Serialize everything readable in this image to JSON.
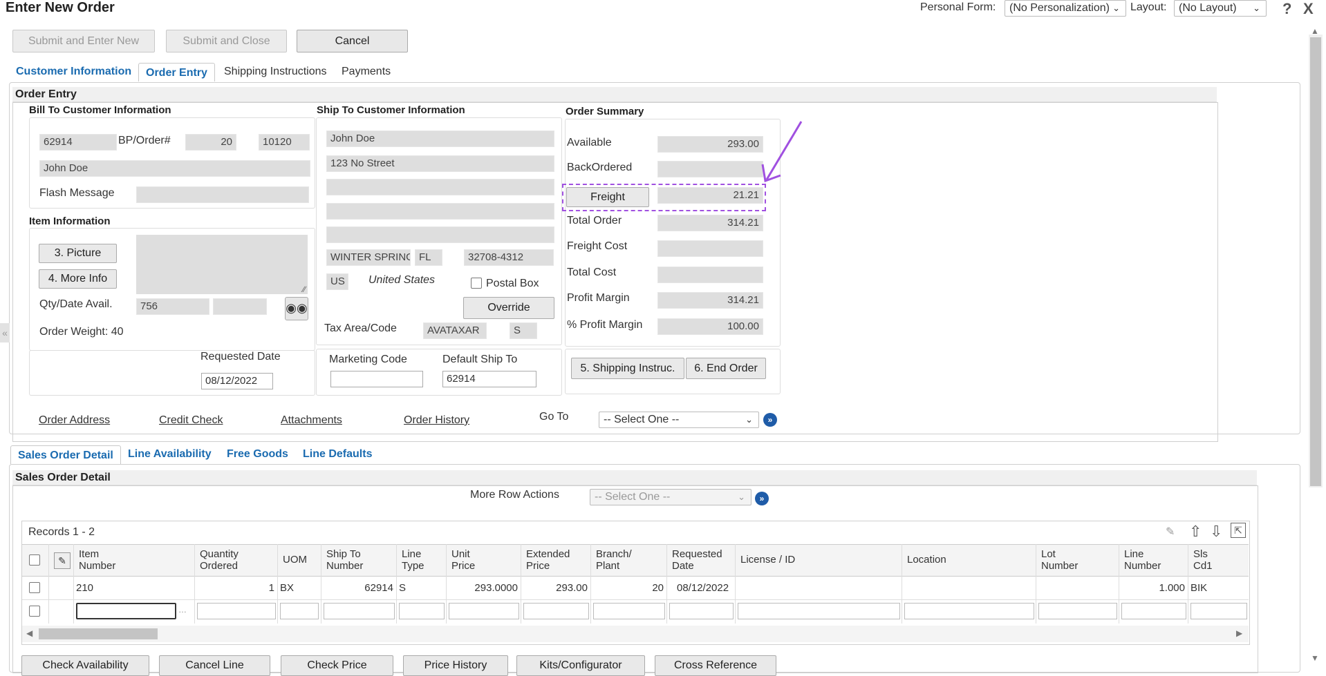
{
  "header": {
    "title": "Enter New Order",
    "personal_form_label": "Personal Form:",
    "personal_form_value": "(No Personalization)",
    "layout_label": "Layout:",
    "layout_value": "(No Layout)",
    "help_glyph": "?",
    "close_glyph": "X"
  },
  "toolbar": {
    "submit_new": "Submit and Enter New",
    "submit_close": "Submit and Close",
    "cancel": "Cancel"
  },
  "tabs": [
    "Customer Information",
    "Order Entry",
    "Shipping Instructions",
    "Payments"
  ],
  "order_entry": {
    "section_title": "Order Entry",
    "bill_to": {
      "title": "Bill To Customer Information",
      "customer_no": "62914",
      "bp_label": "BP/Order#",
      "bp_value": "20",
      "order_no": "10120",
      "name": "John Doe",
      "flash_label": "Flash Message",
      "flash_value": ""
    },
    "ship_to": {
      "title": "Ship To Customer Information",
      "name": "John Doe",
      "street": "123 No Street",
      "city": "WINTER SPRINGS",
      "state": "FL",
      "zip": "32708-4312",
      "country_code": "US",
      "country_name": "United States",
      "postal_box_label": "Postal Box",
      "override": "Override",
      "tax_label": "Tax Area/Code",
      "tax_area": "AVATAXAR",
      "tax_code": "S"
    },
    "item": {
      "title": "Item Information",
      "picture": "3. Picture",
      "more_info": "4. More Info",
      "qty_label": "Qty/Date Avail.",
      "qty_value": "756",
      "weight": "Order Weight: 40",
      "requested_date_label": "Requested Date",
      "requested_date_value": "08/12/2022"
    },
    "marketing": {
      "marketing_label": "Marketing Code",
      "marketing_value": "",
      "default_ship_label": "Default Ship To",
      "default_ship_value": "62914"
    },
    "summary": {
      "title": "Order Summary",
      "available_label": "Available",
      "available": "293.00",
      "backordered_label": "BackOrdered",
      "backordered": "",
      "freight_button": "Freight",
      "freight": "21.21",
      "total_order_label": "Total Order",
      "total_order": "314.21",
      "freight_cost_label": "Freight Cost",
      "freight_cost": "",
      "total_cost_label": "Total Cost",
      "total_cost": "",
      "profit_margin_label": "Profit Margin",
      "profit_margin": "314.21",
      "pct_profit_margin_label": "% Profit Margin",
      "pct_profit_margin": "100.00",
      "shipping_instruc": "5. Shipping Instruc.",
      "end_order": "6. End Order"
    },
    "links": {
      "order_address": "Order Address",
      "credit_check": "Credit Check",
      "attachments": "Attachments",
      "order_history": "Order History",
      "go_to_label": "Go To",
      "go_to_value": "-- Select One --"
    }
  },
  "detail_tabs": [
    "Sales Order Detail",
    "Line Availability",
    "Free Goods",
    "Line Defaults"
  ],
  "detail": {
    "section_title": "Sales Order Detail",
    "more_row_actions_label": "More Row Actions",
    "more_row_actions_value": "-- Select One --",
    "records": "Records 1 - 2",
    "columns": [
      [
        "Item",
        "Number"
      ],
      [
        "Quantity",
        "Ordered"
      ],
      [
        "UOM",
        ""
      ],
      [
        "Ship To",
        "Number"
      ],
      [
        "Line",
        "Type"
      ],
      [
        "Unit",
        "Price"
      ],
      [
        "Extended",
        "Price"
      ],
      [
        "Branch/",
        "Plant"
      ],
      [
        "Requested",
        "Date"
      ],
      [
        "License / ID",
        ""
      ],
      [
        "Location",
        ""
      ],
      [
        "Lot",
        "Number"
      ],
      [
        "Line",
        "Number"
      ],
      [
        "Sls",
        "Cd1"
      ]
    ],
    "row1": {
      "item": "210",
      "qty": "1",
      "uom": "BX",
      "ship_to": "62914",
      "line_type": "S",
      "unit_price": "293.0000",
      "ext_price": "293.00",
      "branch": "20",
      "req_date": "08/12/2022",
      "license": "",
      "location": "",
      "lot": "",
      "line_no": "1.000",
      "sls": "BIK"
    }
  },
  "bottom_buttons": [
    "Check Availability",
    "Cancel Line",
    "Check Price",
    "Price History",
    "Kits/Configurator",
    "Cross Reference"
  ]
}
